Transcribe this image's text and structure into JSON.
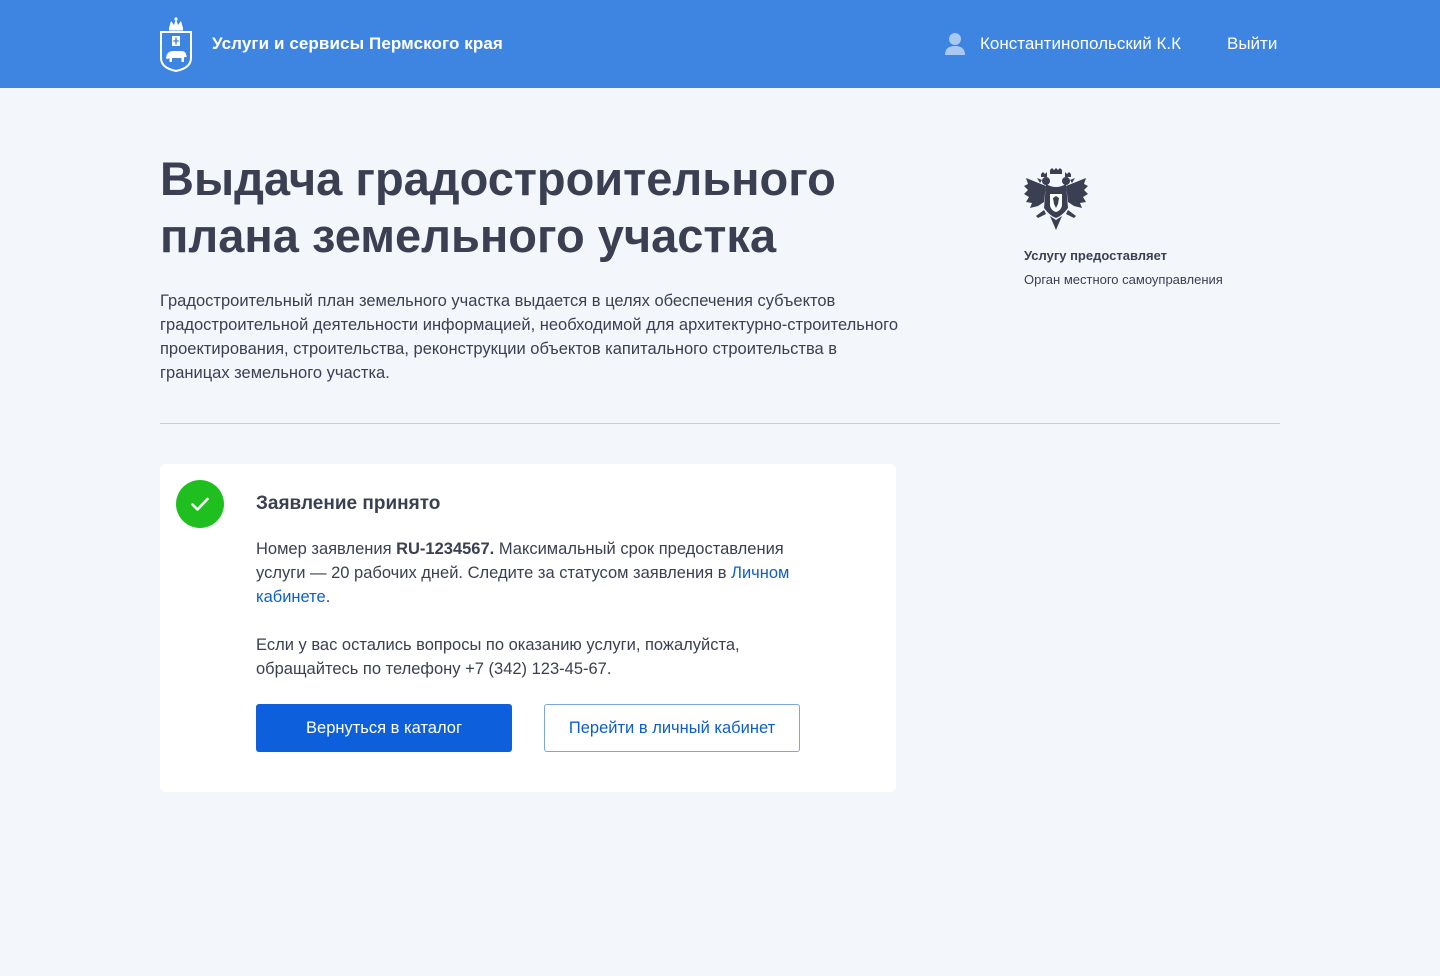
{
  "header": {
    "site_title": "Услуги и сервисы Пермского края",
    "user_name": "Константинопольский К.К",
    "logout_label": "Выйти",
    "background_color": "#3d85e1",
    "logo_icon": "perm-krai-coat-of-arms-icon",
    "user_icon": "user-icon"
  },
  "service": {
    "title": "Выдача градостроительного плана земельного участка",
    "description": "Градостроительный план земельного участка выдается в целях обеспечения субъектов градостроительной деятельности информацией, необходимой для архитектурно-строительного проектирования, строительства, реконструкции объектов капитального строительства в границах земельного участка.",
    "provider_label": "Услугу предоставляет",
    "provider_value": "Орган местного самоуправления",
    "emblem_icon": "double-headed-eagle-emblem-icon"
  },
  "result": {
    "status_icon": "check-circle-icon",
    "status_color": "#1fbf1f",
    "title": "Заявление принято",
    "number_prefix": "Номер заявления ",
    "application_number": "RU-1234567.",
    "number_suffix": " Максимальный срок предоставления услуги — 20 рабочих дней. Следите за статусом заявления в ",
    "cabinet_link": "Личном кабинете",
    "link_suffix": ".",
    "contact_text": "Если у вас остались вопросы по оказанию услуги, пожалуйста, обращайтесь по телефону +7 (342) 123-45-67.",
    "primary_button": "Вернуться в каталог",
    "secondary_button": "Перейти в личный кабинет",
    "primary_color": "#0d5fdb",
    "link_color": "#0d5fc8"
  }
}
